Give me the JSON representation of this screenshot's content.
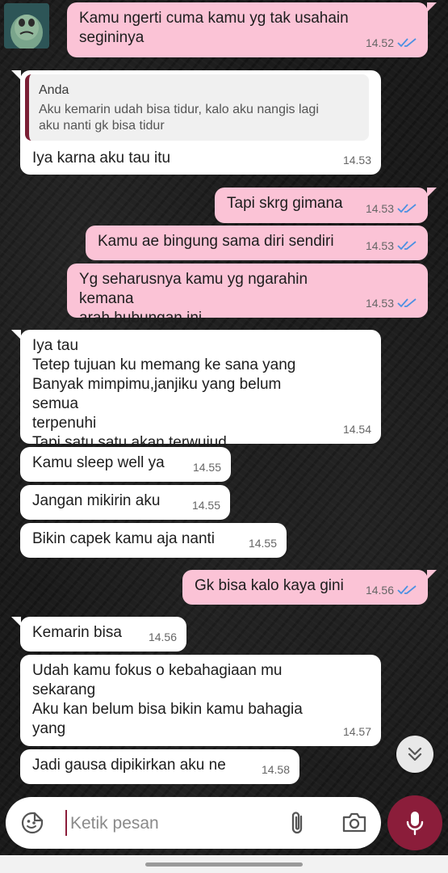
{
  "composer": {
    "placeholder": "Ketik pesan"
  },
  "messages": [
    {
      "dir": "out",
      "text": "Kamu ngerti cuma kamu yg tak usahain\nsegininya",
      "time": "14.52"
    },
    {
      "dir": "in",
      "quote_name": "Anda",
      "quote_text": "Aku kemarin udah bisa tidur, kalo aku nangis lagi\naku nanti gk bisa tidur",
      "text": "Iya karna aku tau itu",
      "time": "14.53"
    },
    {
      "dir": "out",
      "text": "Tapi skrg gimana",
      "time": "14.53"
    },
    {
      "dir": "out",
      "text": "Kamu ae bingung sama diri sendiri",
      "time": "14.53"
    },
    {
      "dir": "out",
      "text": "Yg seharusnya kamu yg ngarahin kemana\narah hubungan ini",
      "time": "14.53"
    },
    {
      "dir": "in",
      "text": "Iya tau\nTetep tujuan ku memang ke sana yang\nBanyak mimpimu,janjiku yang belum semua\nterpenuhi\nTapi satu satu akan terwujud",
      "time": "14.54"
    },
    {
      "dir": "in",
      "text": "Kamu sleep well ya",
      "time": "14.55"
    },
    {
      "dir": "in",
      "text": "Jangan mikirin aku",
      "time": "14.55"
    },
    {
      "dir": "in",
      "text": "Bikin capek kamu aja nanti",
      "time": "14.55"
    },
    {
      "dir": "out",
      "text": "Gk bisa kalo kaya gini",
      "time": "14.56"
    },
    {
      "dir": "in",
      "text": "Kemarin bisa",
      "time": "14.56"
    },
    {
      "dir": "in",
      "text": "Udah kamu fokus o kebahagiaan mu\nsekarang\nAku kan belum bisa bikin kamu bahagia yang",
      "time": "14.57"
    },
    {
      "dir": "in",
      "text": "Jadi gausa dipikirkan aku ne",
      "time": "14.58"
    }
  ],
  "colors": {
    "outgoing_bubble": "#fbc3d6",
    "incoming_bubble": "#ffffff",
    "accent": "#8b1d3a",
    "read_ticks": "#4a90e2"
  }
}
